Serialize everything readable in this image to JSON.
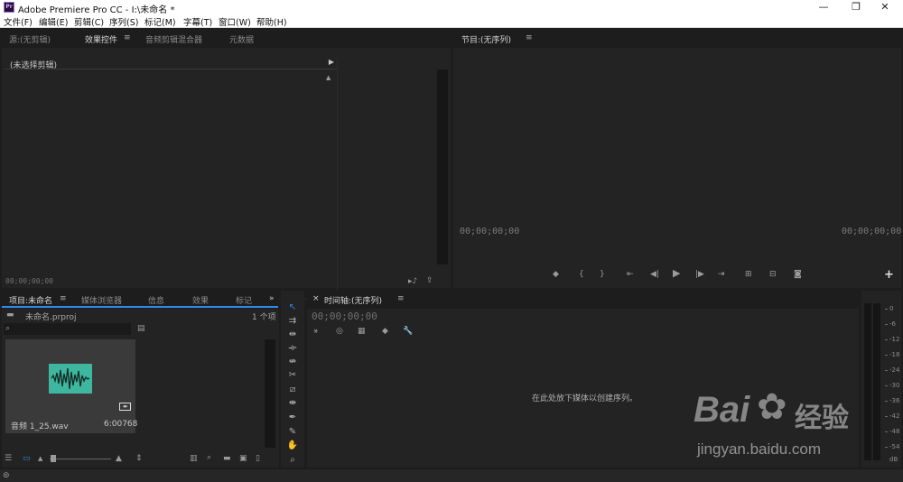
{
  "window": {
    "title": "Adobe Premiere Pro CC - I:\\未命名 *",
    "app_icon_text": "Pr",
    "minimize": "—",
    "maximize": "❐",
    "close": "✕"
  },
  "menu": [
    "文件(F)",
    "编辑(E)",
    "剪辑(C)",
    "序列(S)",
    "标记(M)",
    "字幕(T)",
    "窗口(W)",
    "帮助(H)"
  ],
  "source_panel": {
    "tabs": [
      "源:(无剪辑)",
      "效果控件",
      "音频剪辑混合器",
      "元数据"
    ],
    "active_tab": "效果控件",
    "tab_menu_icon": "≡",
    "no_clip_label": "(未选择剪辑)",
    "timecode": "00;00;00;00"
  },
  "program_panel": {
    "title": "节目:(无序列)",
    "menu_icon": "≡",
    "timecode_left": "00;00;00;00",
    "timecode_right": "00;00;00;00",
    "add_button": "+"
  },
  "project_panel": {
    "tabs": [
      "项目:未命名",
      "媒体浏览器",
      "信息",
      "效果",
      "标记"
    ],
    "active_tab": "项目:未命名",
    "tab_menu_icon": "≡",
    "overflow_icon": "»",
    "project_file": "未命名.prproj",
    "item_count": "1 个项",
    "search_placeholder": "",
    "clip": {
      "name": "音频 1_25.wav",
      "duration": "6:00768"
    }
  },
  "timeline_panel": {
    "close_icon": "×",
    "title": "时间轴:(无序列)",
    "menu_icon": "≡",
    "timecode": "00;00;00;00",
    "drop_hint": "在此处放下媒体以创建序列。"
  },
  "audio_meter": {
    "labels": [
      "0",
      "-6",
      "-12",
      "-18",
      "-24",
      "-30",
      "-36",
      "-42",
      "-48",
      "-54",
      "dB"
    ]
  },
  "watermark": {
    "brand": "Bai",
    "brand2": "经验",
    "url": "jingyan.baidu.com"
  },
  "colors": {
    "accent_blue": "#2d8ceb",
    "waveform": "#3fb6a0",
    "panel_bg": "#232323",
    "app_bg": "#1d1d1d"
  }
}
